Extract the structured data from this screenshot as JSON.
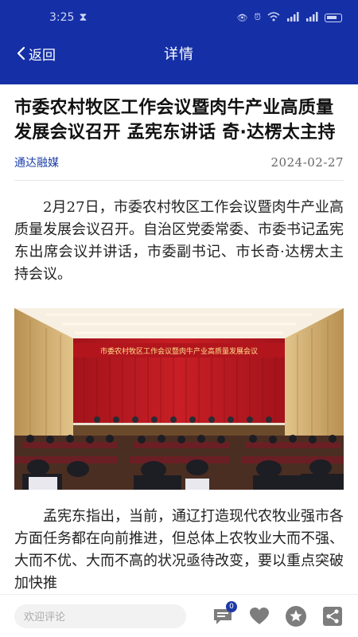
{
  "status_bar": {
    "time": "3:25"
  },
  "nav": {
    "back_label": "返回",
    "title": "详情"
  },
  "article": {
    "title": "市委农村牧区工作会议暨肉牛产业高质量发展会议召开 孟宪东讲话 奇·达楞太主持",
    "source": "通达融媒",
    "date": "2024-02-27",
    "paragraph1": "2月27日，市委农村牧区工作会议暨肉牛产业高质量发展会议召开。自治区党委常委、市委书记孟宪东出席会议并讲话，市委副书记、市长奇·达楞太主持会议。",
    "photo_banner": "市委农村牧区工作会议暨肉牛产业高质量发展会议",
    "paragraph2": "孟宪东指出，当前，通辽打造现代农牧业强市各方面任务都在向前推进，但总体上农牧业大而不强、大而不优、大而不高的状况亟待改变，要以重点突破加快推"
  },
  "bottom_bar": {
    "comment_placeholder": "欢迎评论",
    "comment_count": "0"
  },
  "colors": {
    "header": "#1530a6",
    "accent": "#1b3fa8"
  }
}
